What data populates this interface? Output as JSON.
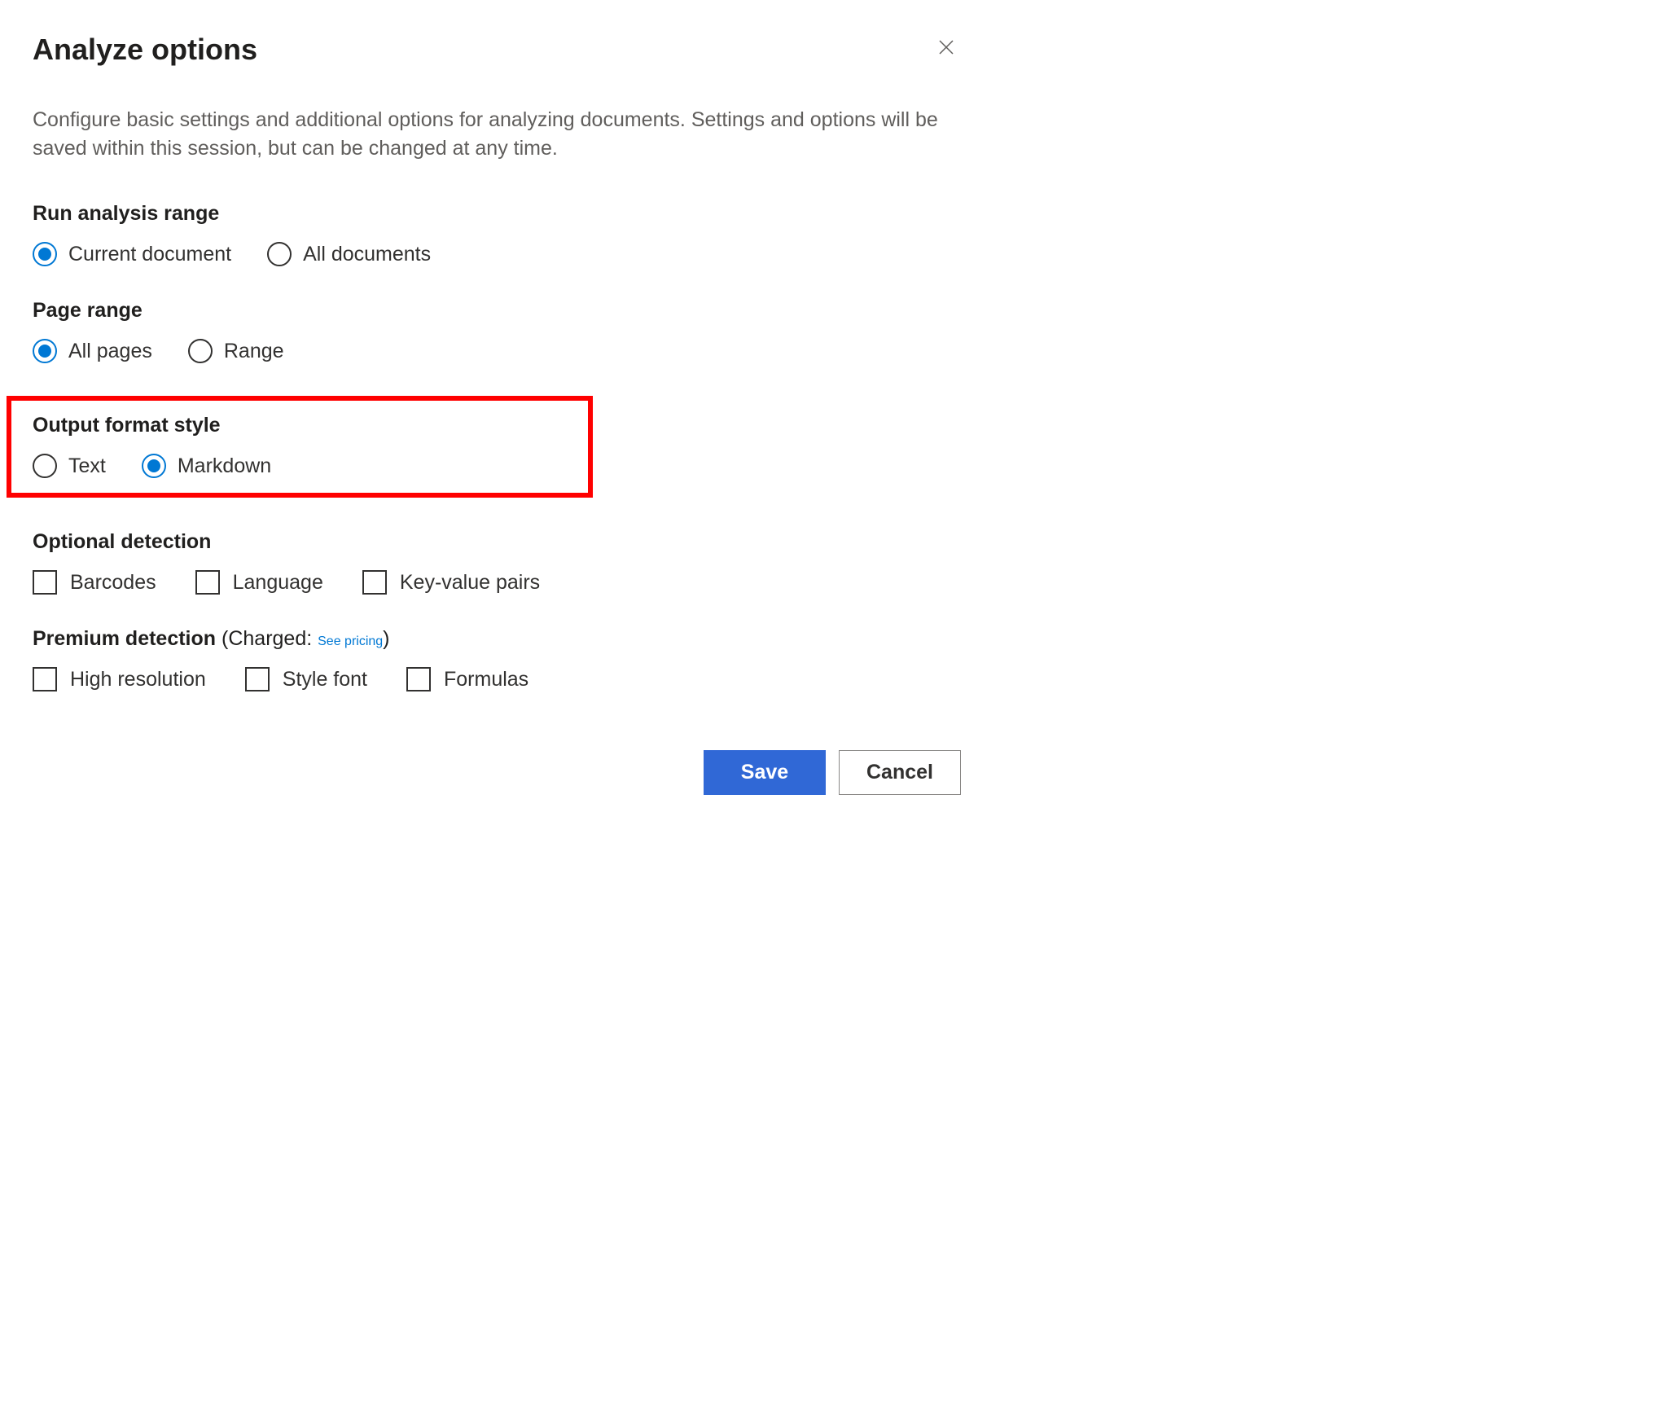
{
  "dialog": {
    "title": "Analyze options",
    "description": "Configure basic settings and additional options for analyzing documents. Settings and options will be saved within this session, but can be changed at any time."
  },
  "sections": {
    "analysis_range": {
      "label": "Run analysis range",
      "options": {
        "current": "Current document",
        "all": "All documents"
      },
      "selected": "current"
    },
    "page_range": {
      "label": "Page range",
      "options": {
        "all": "All pages",
        "range": "Range"
      },
      "selected": "all"
    },
    "output_format": {
      "label": "Output format style",
      "options": {
        "text": "Text",
        "markdown": "Markdown"
      },
      "selected": "markdown"
    },
    "optional_detection": {
      "label": "Optional detection",
      "options": {
        "barcodes": "Barcodes",
        "language": "Language",
        "kvpairs": "Key-value pairs"
      }
    },
    "premium_detection": {
      "label": "Premium detection",
      "charged_prefix": " (Charged: ",
      "pricing_link": "See pricing",
      "charged_suffix": ")",
      "options": {
        "highres": "High resolution",
        "stylefont": "Style font",
        "formulas": "Formulas"
      }
    }
  },
  "buttons": {
    "save": "Save",
    "cancel": "Cancel"
  }
}
